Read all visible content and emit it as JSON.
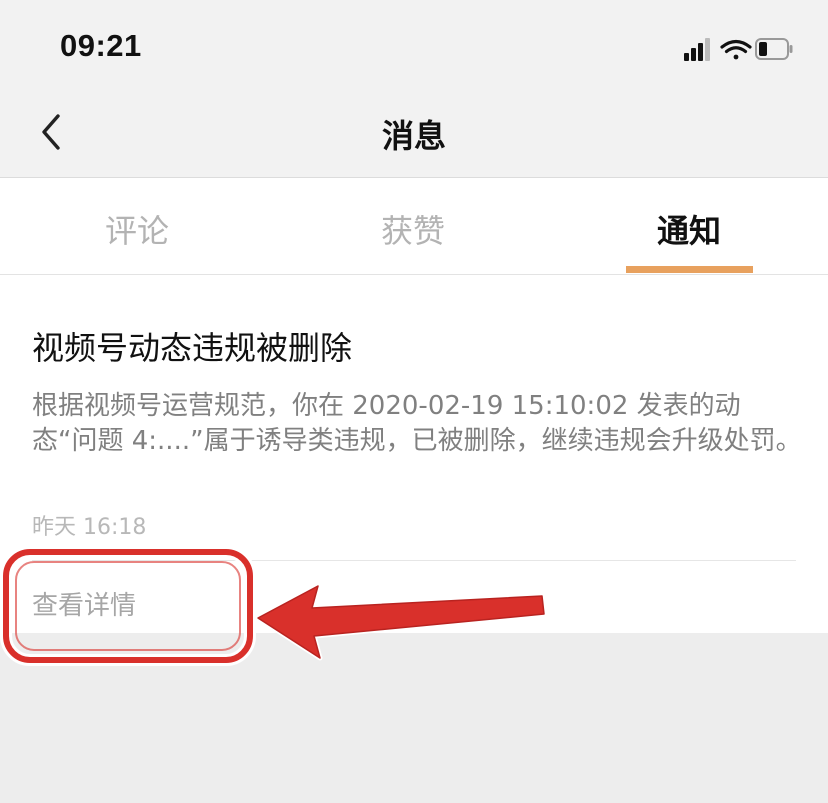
{
  "status_bar": {
    "time": "09:21",
    "icons": [
      "cellular-signal-icon",
      "wifi-icon",
      "battery-icon"
    ]
  },
  "nav": {
    "title": "消息",
    "back_icon": "chevron-left-icon"
  },
  "tabs": [
    {
      "label": "评论",
      "active": false
    },
    {
      "label": "获赞",
      "active": false
    },
    {
      "label": "通知",
      "active": true
    }
  ],
  "notification": {
    "title": "视频号动态违规被删除",
    "body": "根据视频号运营规范，你在 2020-02-19 15:10:02 发表的动态“问题 4:....”属于诱导类违规，已被删除，继续违规会升级处罚。",
    "time": "昨天 16:18",
    "action_label": "查看详情"
  },
  "colors": {
    "accent_underline": "#e8a15e",
    "annotation_red": "#d9302b",
    "page_background": "#ededed"
  }
}
